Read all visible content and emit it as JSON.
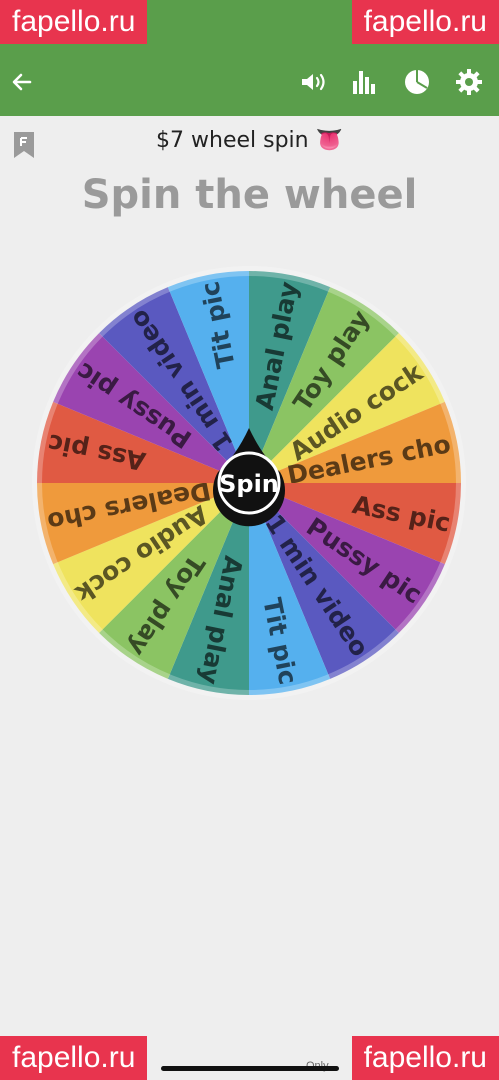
{
  "watermark": {
    "text": "fapello.ru"
  },
  "app_bar": {
    "back_icon": "arrow-left-icon",
    "sound_icon": "volume-icon",
    "stats_icon": "bar-chart-icon",
    "pie_icon": "pie-chart-icon",
    "settings_icon": "gear-icon"
  },
  "wheel": {
    "title": "$7 wheel spin 👅",
    "heading": "Spin the wheel",
    "spin_label": "Spin",
    "segments": [
      {
        "label": "Anal play",
        "color": "#3f9a8c"
      },
      {
        "label": "Toy play",
        "color": "#8bc463"
      },
      {
        "label": "Audio cock",
        "color": "#efe35e"
      },
      {
        "label": "Dealers cho",
        "color": "#ef9a3c"
      },
      {
        "label": "Ass pic",
        "color": "#e05a43"
      },
      {
        "label": "Pussy pic",
        "color": "#9a44b0"
      },
      {
        "label": "1 min video",
        "color": "#5a59c0"
      },
      {
        "label": "Tit pic",
        "color": "#55b0ee"
      },
      {
        "label": "Anal play",
        "color": "#3f9a8c"
      },
      {
        "label": "Toy play",
        "color": "#8bc463"
      },
      {
        "label": "Audio cock",
        "color": "#efe35e"
      },
      {
        "label": "Dealers cho",
        "color": "#ef9a3c"
      },
      {
        "label": "Ass pic",
        "color": "#e05a43"
      },
      {
        "label": "Pussy pic",
        "color": "#9a44b0"
      },
      {
        "label": "1 min video",
        "color": "#5a59c0"
      },
      {
        "label": "Tit pic",
        "color": "#55b0ee"
      }
    ]
  },
  "footer": {
    "text": "Only"
  }
}
